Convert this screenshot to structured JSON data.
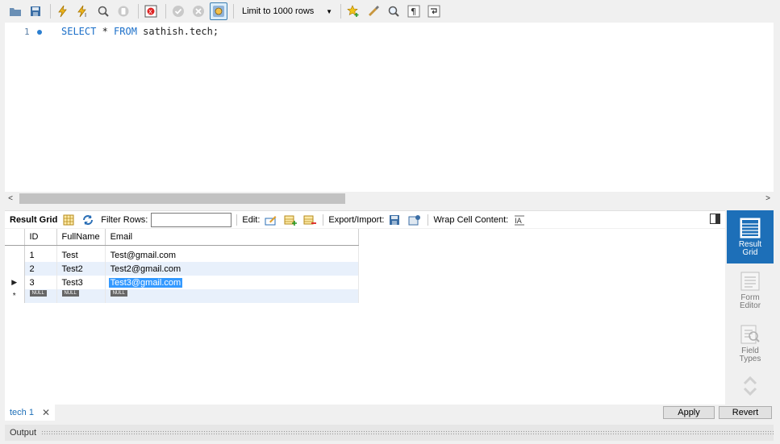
{
  "toolbar": {
    "limit_label": "Limit to 1000 rows"
  },
  "editor": {
    "line_number": "1",
    "query": {
      "kw1": "SELECT",
      "star": " * ",
      "kw2": "FROM",
      "rest": " sathish.tech;"
    }
  },
  "result_toolbar": {
    "result_grid": "Result Grid",
    "filter_rows": "Filter Rows:",
    "filter_value": "",
    "edit": "Edit:",
    "export_import": "Export/Import:",
    "wrap_cell": "Wrap Cell Content:"
  },
  "grid": {
    "columns": [
      "ID",
      "FullName",
      "Email"
    ],
    "rows": [
      {
        "id": "1",
        "fullname": "Test",
        "email": "Test@gmail.com"
      },
      {
        "id": "2",
        "fullname": "Test2",
        "email": "Test2@gmail.com"
      },
      {
        "id": "3",
        "fullname": "Test3",
        "email": "Test3@gmail.com"
      }
    ],
    "null_label": "NULL"
  },
  "side_panel": {
    "result_grid": "Result Grid",
    "form_editor": "Form Editor",
    "field_types": "Field Types"
  },
  "bottom": {
    "tab_label": "tech 1",
    "apply": "Apply",
    "revert": "Revert"
  },
  "output": {
    "label": "Output"
  },
  "colors": {
    "accent": "#1d6fb8",
    "keyword": "#1b6fc9",
    "selection": "#3399ff"
  }
}
